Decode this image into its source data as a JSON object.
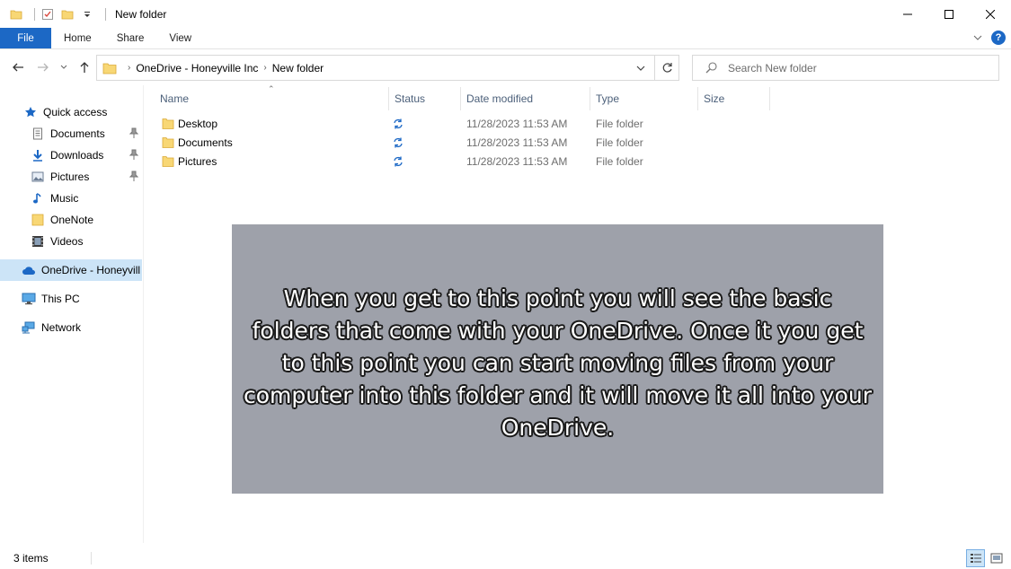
{
  "window": {
    "title": "New folder",
    "minimize_symbol": "—",
    "maximize_symbol": "☐",
    "close_symbol": "✕"
  },
  "ribbon": {
    "tabs": [
      {
        "label": "File",
        "active": true
      },
      {
        "label": "Home"
      },
      {
        "label": "Share"
      },
      {
        "label": "View"
      }
    ],
    "help_label": "?"
  },
  "address": {
    "breadcrumbs": [
      "OneDrive - Honeyville Inc",
      "New folder"
    ]
  },
  "search": {
    "placeholder": "Search New folder"
  },
  "sidebar": {
    "items": [
      {
        "label": "Quick access",
        "icon": "star-icon"
      },
      {
        "label": "Documents",
        "icon": "documents-icon",
        "pinned": true
      },
      {
        "label": "Downloads",
        "icon": "download-arrow-icon",
        "pinned": true
      },
      {
        "label": "Pictures",
        "icon": "pictures-icon",
        "pinned": true
      },
      {
        "label": "Music",
        "icon": "music-note-icon"
      },
      {
        "label": "OneNote",
        "icon": "folder-icon"
      },
      {
        "label": "Videos",
        "icon": "film-icon"
      },
      {
        "label": "OneDrive - Honeyvill",
        "icon": "cloud-icon",
        "selected": true
      },
      {
        "label": "This PC",
        "icon": "monitor-icon"
      },
      {
        "label": "Network",
        "icon": "network-icon"
      }
    ]
  },
  "columns": {
    "name": "Name",
    "status": "Status",
    "date_modified": "Date modified",
    "type": "Type",
    "size": "Size"
  },
  "files": [
    {
      "name": "Desktop",
      "status": "sync-icon",
      "date": "11/28/2023 11:53 AM",
      "type": "File folder"
    },
    {
      "name": "Documents",
      "status": "sync-icon",
      "date": "11/28/2023 11:53 AM",
      "type": "File folder"
    },
    {
      "name": "Pictures",
      "status": "sync-icon",
      "date": "11/28/2023 11:53 AM",
      "type": "File folder"
    }
  ],
  "overlay": {
    "caption": "When you get to this point you will see the basic folders that come with your OneDrive.  Once it you get to this point you can start moving files from your computer into this folder and it will move it all into your OneDrive."
  },
  "status_bar": {
    "item_count": "3 items"
  },
  "colors": {
    "accent": "#1c68c5",
    "selection": "#cce4f7",
    "folder": "#f8d775",
    "sync": "#1c68c5",
    "overlay": "#9ea1aa"
  }
}
